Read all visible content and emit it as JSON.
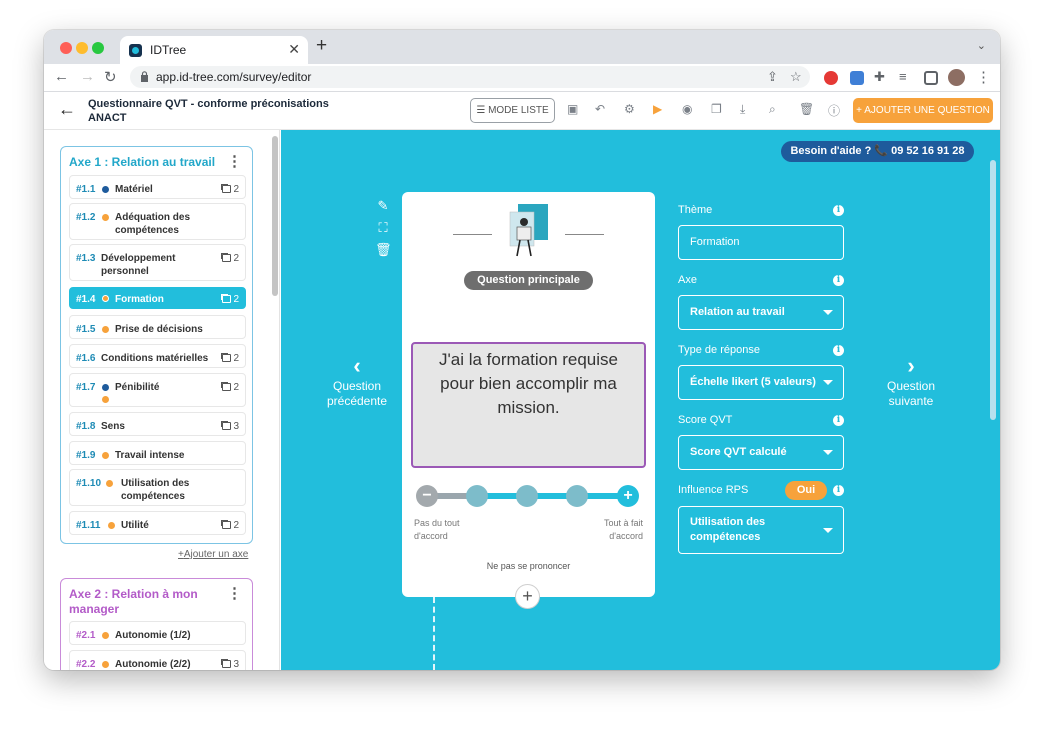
{
  "browser": {
    "tab_title": "IDTree",
    "url": "app.id-tree.com/survey/editor",
    "traffic_lights": [
      "#fe5f57",
      "#febc2e",
      "#28c840"
    ]
  },
  "header": {
    "survey_title": "Questionnaire QVT - conforme préconisations ANACT",
    "mode_liste": "MODE LISTE",
    "add_question": "AJOUTER UNE QUESTION",
    "accent_color": "#f7a23b"
  },
  "sidebar": {
    "axes": [
      {
        "title": "Axe 1 : Relation au travail",
        "color": "#22a7c9",
        "items": [
          {
            "num": "#1.1",
            "label": "Matériel",
            "dot": "#1e5b9c",
            "count": "2"
          },
          {
            "num": "#1.2",
            "label": "Adéquation des compétences",
            "dot": "#f7a23b",
            "count": ""
          },
          {
            "num": "#1.3",
            "label": "Développement personnel",
            "dot": "",
            "count": "2"
          },
          {
            "num": "#1.4",
            "label": "Formation",
            "dot": "#f7a23b",
            "count": "2",
            "active": true
          },
          {
            "num": "#1.5",
            "label": "Prise de décisions",
            "dot": "#f7a23b",
            "count": ""
          },
          {
            "num": "#1.6",
            "label": "Conditions matérielles",
            "dot": "",
            "count": "2"
          },
          {
            "num": "#1.7",
            "label": "Pénibilité",
            "dot": "#1e5b9c",
            "count": "2"
          },
          {
            "num": "#1.8",
            "label": "Sens",
            "dot": "",
            "count": "3"
          },
          {
            "num": "#1.9",
            "label": "Travail intense",
            "dot": "#f7a23b",
            "count": ""
          },
          {
            "num": "#1.10",
            "label": "Utilisation des compétences",
            "dot": "#f7a23b",
            "count": ""
          },
          {
            "num": "#1.11",
            "label": "Utilité",
            "dot": "#f7a23b",
            "count": "2"
          }
        ]
      },
      {
        "title": "Axe 2 : Relation à mon manager",
        "color": "#b35bc8",
        "items": [
          {
            "num": "#2.1",
            "label": "Autonomie (1/2)",
            "dot": "#f7a23b",
            "count": ""
          },
          {
            "num": "#2.2",
            "label": "Autonomie (2/2)",
            "dot": "#f7a23b",
            "count": "3"
          }
        ]
      }
    ],
    "add_axe": "Ajouter un axe"
  },
  "main": {
    "help": "Besoin d'aide ? 📞 09 52 16 91 28",
    "prev": "Question précédente",
    "next": "Question suivante",
    "card": {
      "badge": "Question principale",
      "question": "J'ai la formation requise pour bien accomplir ma mission.",
      "scale_min": "Pas du tout d'accord",
      "scale_max": "Tout à fait d'accord",
      "no_opinion": "Ne pas se prononcer"
    },
    "fields": {
      "theme_label": "Thème",
      "theme_value": "Formation",
      "axe_label": "Axe",
      "axe_value": "Relation au travail",
      "type_label": "Type de réponse",
      "type_value": "Échelle likert (5 valeurs)",
      "score_label": "Score QVT",
      "score_value": "Score QVT calculé",
      "rps_label": "Influence RPS",
      "rps_toggle": "Oui",
      "rps_value": "Utilisation des compétences"
    },
    "bg_color": "#22bedc"
  }
}
